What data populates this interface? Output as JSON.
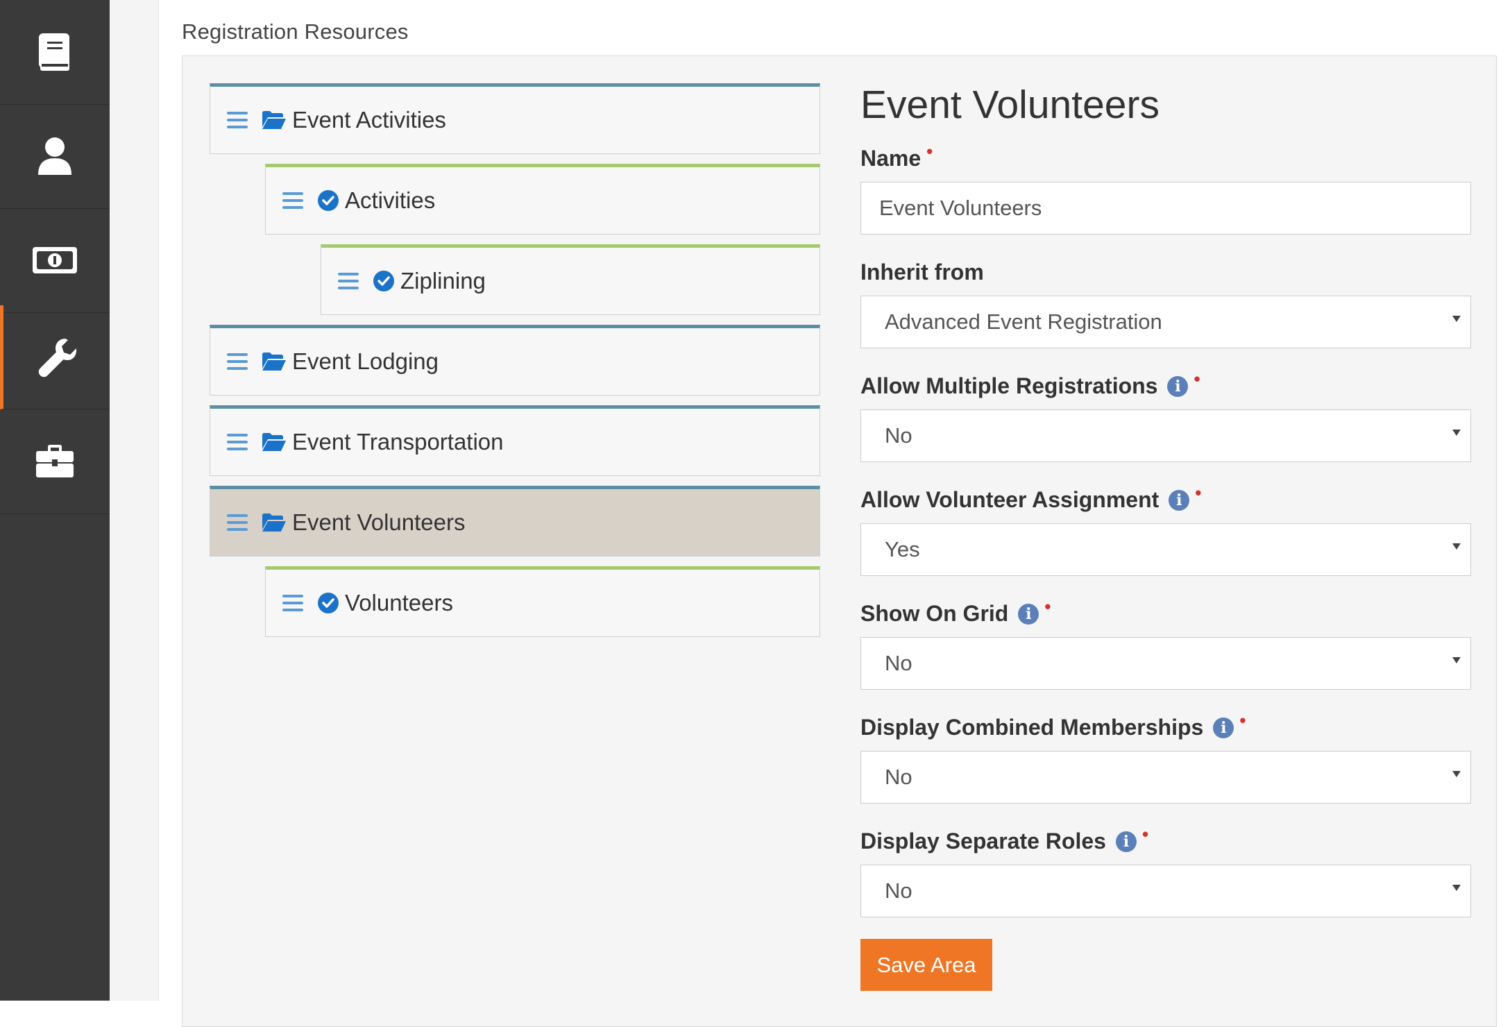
{
  "sidebar": {
    "items": [
      {
        "icon": "book-icon"
      },
      {
        "icon": "person-icon"
      },
      {
        "icon": "money-icon"
      },
      {
        "icon": "wrench-icon",
        "active": true
      },
      {
        "icon": "briefcase-icon"
      }
    ]
  },
  "section_title": "Registration Resources",
  "tree": {
    "nodes": [
      {
        "label": "Event Activities",
        "type": "area",
        "icon": "folder-open-icon"
      },
      {
        "label": "Activities",
        "type": "resource",
        "icon": "check-circle-icon"
      },
      {
        "label": "Ziplining",
        "type": "resource",
        "icon": "check-circle-icon"
      },
      {
        "label": "Event Lodging",
        "type": "area",
        "icon": "folder-open-icon"
      },
      {
        "label": "Event Transportation",
        "type": "area",
        "icon": "folder-open-icon"
      },
      {
        "label": "Event Volunteers",
        "type": "area",
        "icon": "folder-open-icon",
        "selected": true
      },
      {
        "label": "Volunteers",
        "type": "resource",
        "icon": "check-circle-icon"
      }
    ]
  },
  "form": {
    "title": "Event Volunteers",
    "name_label": "Name",
    "name_value": "Event Volunteers",
    "inherit_label": "Inherit from",
    "inherit_value": "Advanced Event Registration",
    "allow_multiple_label": "Allow Multiple Registrations",
    "allow_multiple_value": "No",
    "allow_volunteer_label": "Allow Volunteer Assignment",
    "allow_volunteer_value": "Yes",
    "show_on_grid_label": "Show On Grid",
    "show_on_grid_value": "No",
    "combined_label": "Display Combined Memberships",
    "combined_value": "No",
    "separate_label": "Display Separate Roles",
    "separate_value": "No",
    "required_marker": "•",
    "info_glyph": "i",
    "save_label": "Save Area"
  },
  "colors": {
    "sidebar_bg": "#3a3a3a",
    "accent": "#ee7625",
    "area_border": "#5b8fa6",
    "resource_border": "#a5c96d",
    "icon_blue": "#1a73c9",
    "required": "#d9302c"
  }
}
